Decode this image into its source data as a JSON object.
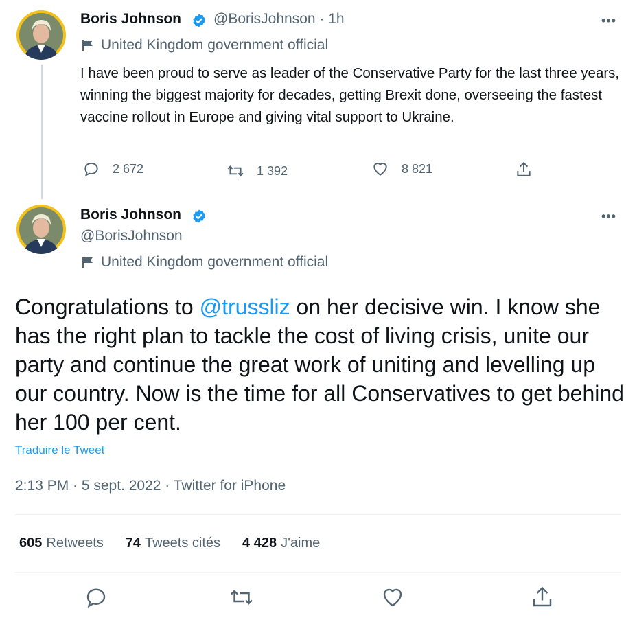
{
  "tweet1": {
    "name": "Boris Johnson",
    "handle": "@BorisJohnson",
    "time": "· 1h",
    "more": "•••",
    "gov_label": "United Kingdom government official",
    "text": "I have been proud to serve as leader of the Conservative Party for the last three years, winning the biggest majority for decades, getting Brexit done, overseeing the fastest vaccine rollout in Europe and giving vital support to Ukraine.",
    "replies": "2 672",
    "retweets": "1 392",
    "likes": "8 821"
  },
  "tweet2": {
    "name": "Boris Johnson",
    "handle": "@BorisJohnson",
    "more": "•••",
    "gov_label": "United Kingdom government official",
    "text_before": "Congratulations to ",
    "mention": "@trussliz",
    "text_after": " on her decisive win. I know she has the right plan to tackle the cost of living crisis, unite our party and continue the great work of uniting and levelling up our country. Now is the time for all Conservatives to get behind her 100 per cent.",
    "translate": "Traduire le Tweet",
    "meta": "2:13 PM · 5 sept. 2022 · Twitter for iPhone",
    "stats": {
      "retweets_count": "605",
      "retweets_label": "Retweets",
      "quotes_count": "74",
      "quotes_label": "Tweets cités",
      "likes_count": "4 428",
      "likes_label": "J'aime"
    }
  },
  "icons": {
    "verified": "verified-badge-icon",
    "flag": "flag-icon",
    "reply": "reply-icon",
    "retweet": "retweet-icon",
    "like": "heart-icon",
    "share": "share-icon"
  },
  "colors": {
    "accent": "#1d9bf0",
    "secondary_text": "#536471",
    "primary_text": "#0f1419",
    "avatar_ring": "#f5c518"
  }
}
